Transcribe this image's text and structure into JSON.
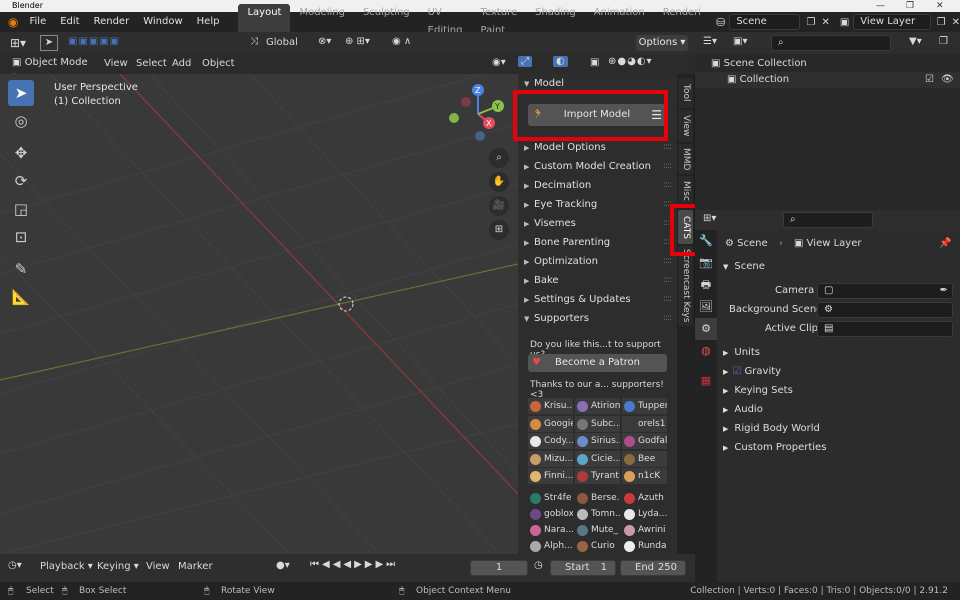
{
  "window": {
    "title": "Blender",
    "controls": [
      "—",
      "❐",
      "✕"
    ]
  },
  "menu": {
    "items": [
      "File",
      "Edit",
      "Render",
      "Window",
      "Help"
    ]
  },
  "workspace_tabs": [
    "Layout",
    "Modeling",
    "Sculpting",
    "UV Editing",
    "Texture Paint",
    "Shading",
    "Animation",
    "Renderi"
  ],
  "scene_name": "Scene",
  "view_layer": "View Layer",
  "toolbar": {
    "transform_orientation": "Global",
    "options": "Options"
  },
  "viewport_header": {
    "mode": "Object Mode",
    "menus": [
      "View",
      "Select",
      "Add",
      "Object"
    ]
  },
  "viewport": {
    "perspective": "User Perspective",
    "collection": "(1) Collection",
    "gizmo": {
      "x": "X",
      "y": "Y",
      "z": "Z"
    }
  },
  "npanel": {
    "model_header": "Model",
    "import_button": "Import Model",
    "sections": [
      "Model Options",
      "Custom Model Creation",
      "Decimation",
      "Eye Tracking",
      "Visemes",
      "Bone Parenting",
      "Optimization",
      "Bake",
      "Settings & Updates",
      "Supporters"
    ],
    "support_text": "Do you like this...t to support us?",
    "patron_button": "Become a Patron",
    "thanks_text": "Thanks to our a... supporters! <3",
    "supporters": [
      "Krisu...",
      "Atirion",
      "Tupper",
      "Googie",
      "Subc...",
      "orels1",
      "Cody...",
      "Sirius...",
      "Godfall",
      "Mizu...",
      "Cicie...",
      "Bee",
      "Finni...",
      "Tyrant",
      "n1cK",
      "Str4fe",
      "Berse...",
      "Azuth",
      "goblox",
      "Tomn...",
      "Lyda...",
      "Nara...",
      "Mute_",
      "Awrini",
      "Alph...",
      "Curio",
      "Runda"
    ],
    "supporter_colors": [
      "#c9663a",
      "#8a6fb5",
      "#4a7ac9",
      "#d88a3f",
      "#777777",
      "#3a3a3a",
      "#e8e8e8",
      "#6b8cc7",
      "#b14c8a",
      "#c99b6b",
      "#5aa5c9",
      "#8a6a3f",
      "#e1b56e",
      "#b03a3a",
      "#d6a05a",
      "#2a7a6a",
      "#8a5a3a",
      "#c93a3a",
      "#6a4a8a",
      "#bbbbbb",
      "#e8e8e8",
      "#cc6699",
      "#557788",
      "#cc99aa",
      "#aaaaaa",
      "#996644",
      "#eeeeee"
    ]
  },
  "side_tabs": [
    "Tool",
    "View",
    "MMD",
    "Misc",
    "CATS",
    "Screencast Keys"
  ],
  "outliner": {
    "root": "Scene Collection",
    "child": "Collection"
  },
  "properties": {
    "scene_label": "Scene",
    "view_layer_label": "View Layer",
    "panel_title": "Scene",
    "fields": [
      "Camera",
      "Background Scene",
      "Active Clip"
    ],
    "sections": [
      "Units",
      "Gravity",
      "Keying Sets",
      "Audio",
      "Rigid Body World",
      "Custom Properties"
    ]
  },
  "timeline": {
    "menus": [
      "Playback",
      "Keying",
      "View",
      "Marker"
    ],
    "current_frame": "1",
    "start_label": "Start",
    "start": "1",
    "end_label": "End",
    "end": "250"
  },
  "status": {
    "select": "Select",
    "box_select": "Box Select",
    "rotate": "Rotate View",
    "context": "Object Context Menu",
    "info": "Collection | Verts:0 | Faces:0 | Tris:0 | Objects:0/0 | 2.91.2"
  },
  "colors": {
    "highlight": "#e8000b",
    "accent": "#4772b3",
    "x_axis": "#e64b5c",
    "y_axis": "#8bc34a",
    "z_axis": "#4a84e0"
  }
}
